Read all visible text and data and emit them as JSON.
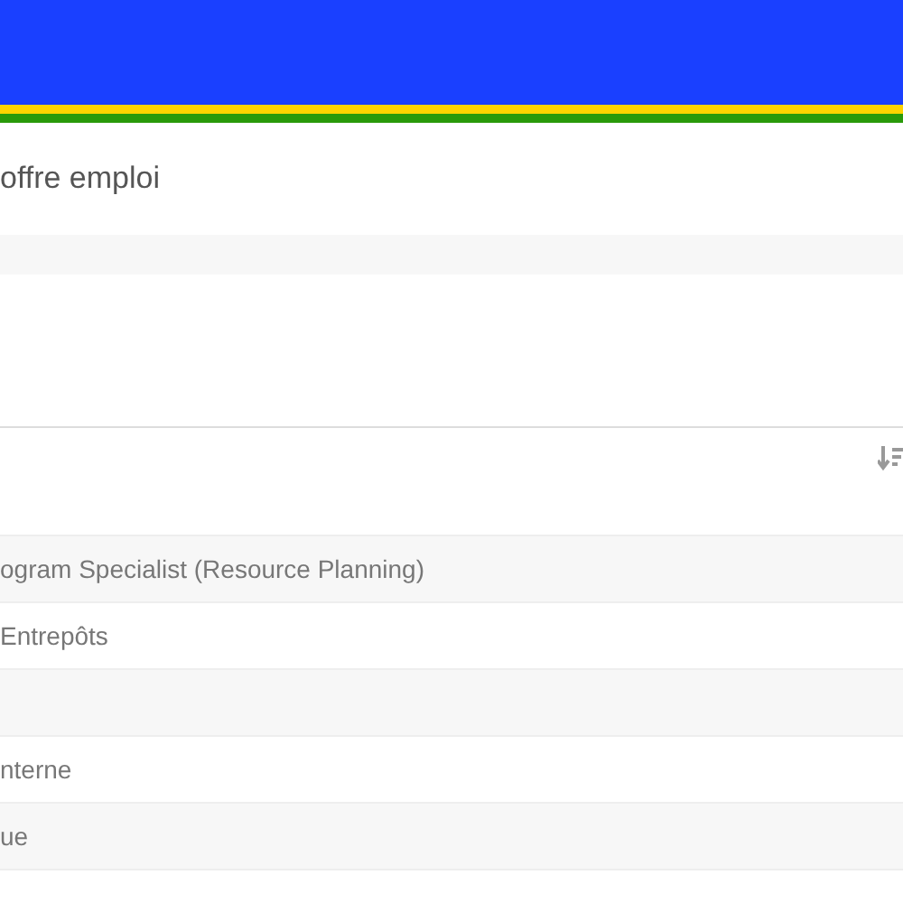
{
  "title": "offre emploi",
  "rows": [
    {
      "text": "ogram Specialist (Resource Planning)"
    },
    {
      "text": "Entrepôts"
    },
    {},
    {
      "text": "nterne"
    },
    {
      "text": "ue"
    }
  ]
}
